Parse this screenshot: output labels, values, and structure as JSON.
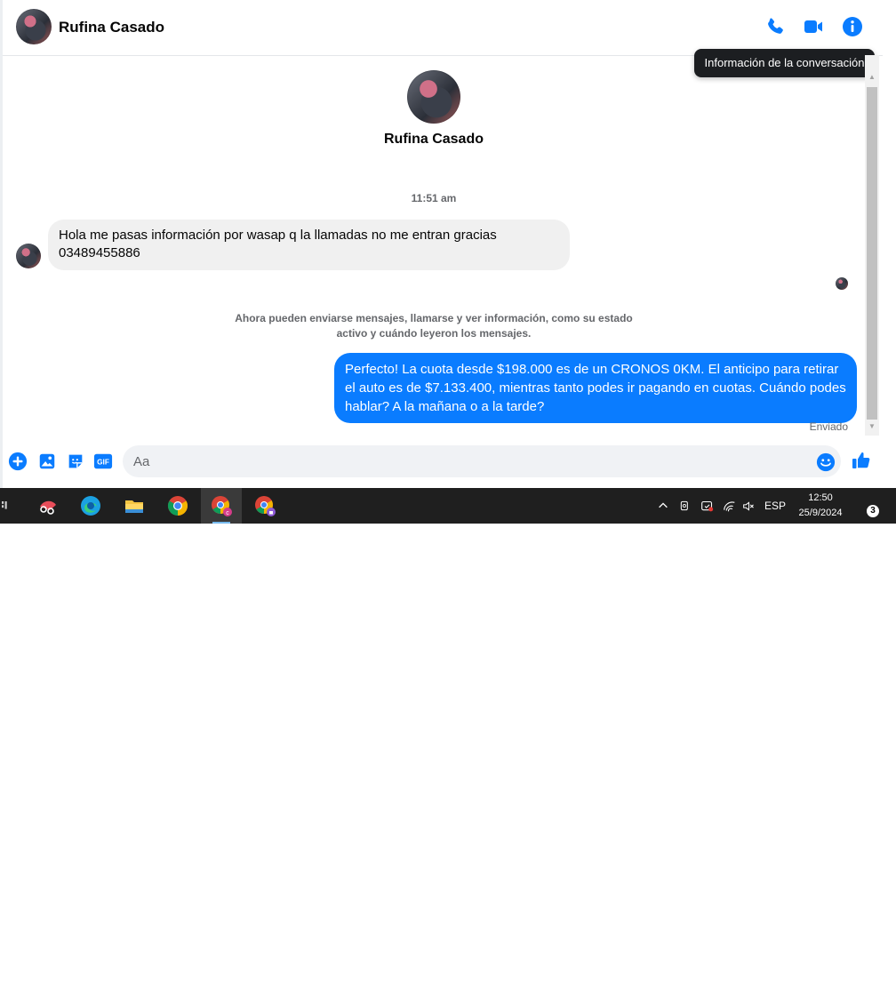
{
  "contact": {
    "name": "Rufina Casado",
    "profile_name": "Rufina Casado"
  },
  "header": {
    "tooltip": "Información de la conversación",
    "icons": [
      "phone-icon",
      "video-call-icon",
      "info-icon"
    ]
  },
  "conversation": {
    "timestamp": "11:51 am",
    "incoming": {
      "line1": "Hola me pasas información por wasap q la llamadas no me entran gracias",
      "line2": "03489455886"
    },
    "system_message": {
      "line1": "Ahora pueden enviarse mensajes, llamarse y ver información, como su estado",
      "line2": "activo y cuándo leyeron los mensajes."
    },
    "outgoing": "Perfecto! La cuota desde $198.000 es de un CRONOS 0KM. El anticipo para retirar el auto es de $7.133.400, mientras tanto podes ir pagando en cuotas. Cuándo podes hablar? A la mañana o a la tarde?",
    "status": "Enviado"
  },
  "composer": {
    "placeholder": "Aa",
    "gif_label": "GIF"
  },
  "colors": {
    "accent": "#0a7cff",
    "incoming_bubble": "#f0f0f0",
    "taskbar": "#1f1f1f"
  },
  "taskbar": {
    "apps": [
      "snipping-tool",
      "edge",
      "file-explorer",
      "chrome",
      "chrome-profile-c",
      "chrome-profile-locked"
    ],
    "language": "ESP",
    "time": "12:50",
    "date": "25/9/2024",
    "notification_count": "3"
  }
}
